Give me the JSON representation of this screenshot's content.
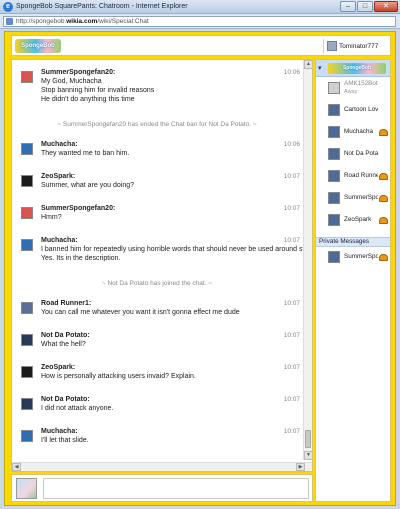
{
  "window": {
    "title": "SpongeBob SquarePants: Chatroom - Internet Explorer",
    "buttons": {
      "minimize": "–",
      "maximize": "□",
      "close": "✕"
    }
  },
  "address": {
    "prefix": "http://",
    "domain_start": "spongebob.",
    "domain_bold": "wikia.com",
    "path": "/wiki/Special:Chat"
  },
  "header": {
    "logo_text": "SpongeBob",
    "current_user": "Tominator777"
  },
  "messages": [
    {
      "type": "msg",
      "user": "SummerSpongefan20:",
      "time": "10:06",
      "lines": [
        "My God, Muchacha",
        "Stop banning him for invalid reasons",
        "He didn't do anything this time"
      ]
    },
    {
      "type": "alert",
      "text": "~ SummerSpongefan20 has ended the Chat ban for Not Da Potato. ~"
    },
    {
      "type": "msg",
      "user": "Muchacha:",
      "time": "10:06",
      "lines": [
        "They wanted me to ban him."
      ]
    },
    {
      "type": "msg",
      "user": "ZeoSpark:",
      "time": "10:07",
      "lines": [
        "Summer, what are you doing?"
      ]
    },
    {
      "type": "msg",
      "user": "SummerSpongefan20:",
      "time": "10:07",
      "lines": [
        "Hmm?"
      ]
    },
    {
      "type": "msg",
      "user": "Muchacha:",
      "time": "10:07",
      "lines": [
        "I banned him for repeatedly using horrible words that should never be used around strangerz.",
        "Yes.  Its in the description."
      ]
    },
    {
      "type": "alert",
      "text": "~ Not Da Potato has joined the chat. ~"
    },
    {
      "type": "msg",
      "user": "Road Runner1:",
      "time": "10:07",
      "lines": [
        "You can call me whatever you want it isn't gonna effect me dude"
      ]
    },
    {
      "type": "msg",
      "user": "Not Da Potato:",
      "time": "10:07",
      "lines": [
        "What the hell?"
      ]
    },
    {
      "type": "msg",
      "user": "ZeoSpark:",
      "time": "10:07",
      "lines": [
        "How is personally attacking users invaid? Explain."
      ]
    },
    {
      "type": "msg",
      "user": "Not Da Potato:",
      "time": "10:07",
      "lines": [
        "I did not attack anyone."
      ]
    },
    {
      "type": "msg",
      "user": "Muchacha:",
      "time": "10:07",
      "lines": [
        "I'll let that slide."
      ]
    }
  ],
  "sidebar": {
    "room_logo_text": "SpongeBob",
    "users": [
      {
        "name": "AMK152Bot",
        "status": "Away",
        "away": true,
        "hat": false
      },
      {
        "name": "Cartoon Lover...",
        "status": "",
        "away": false,
        "hat": false
      },
      {
        "name": "Muchacha",
        "status": "",
        "away": false,
        "hat": true
      },
      {
        "name": "Not Da Potato",
        "status": "",
        "away": false,
        "hat": false
      },
      {
        "name": "Road Runner1",
        "status": "",
        "away": false,
        "hat": true
      },
      {
        "name": "SummerSpon...",
        "status": "",
        "away": false,
        "hat": true
      },
      {
        "name": "ZeoSpark",
        "status": "",
        "away": false,
        "hat": true
      }
    ],
    "pm_header": "Private Messages",
    "pm_users": [
      {
        "name": "SummerSpon...",
        "hat": true
      }
    ]
  },
  "colors": {
    "frame": "#ffd700",
    "avatars": {
      "SummerSpongefan20:": "#d9534f",
      "Muchacha:": "#2f6db5",
      "ZeoSpark:": "#1b1b1b",
      "Road Runner1:": "#5a6f99",
      "Not Da Potato:": "#263a5c"
    }
  }
}
